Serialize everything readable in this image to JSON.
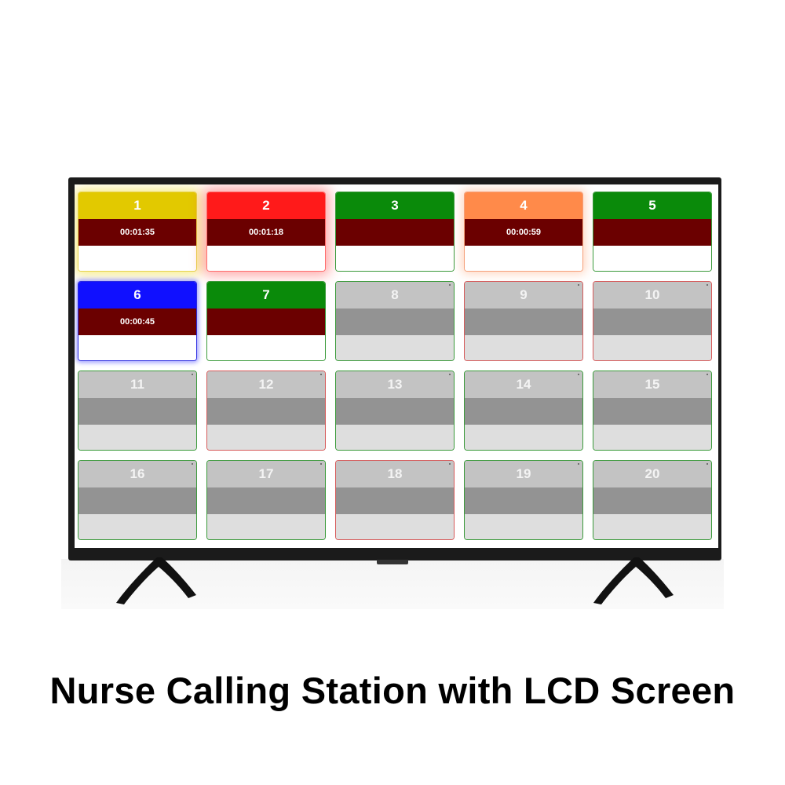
{
  "caption": "Nurse Calling Station with LCD Screen",
  "colors": {
    "active_yellow": "#e2c900",
    "active_red": "#ff1a1a",
    "active_orange": "#ff8a4a",
    "active_blue": "#1010ff",
    "ready_green": "#0a8a0a",
    "timer_band": "#6b0000",
    "idle_gray": "#c3c3c3"
  },
  "beds": [
    {
      "number": "1",
      "timer": "00:01:35",
      "state": "active",
      "color": "#e2c900"
    },
    {
      "number": "2",
      "timer": "00:01:18",
      "state": "active",
      "color": "#ff1a1a"
    },
    {
      "number": "3",
      "timer": "",
      "state": "ready",
      "color": "#0a8a0a"
    },
    {
      "number": "4",
      "timer": "00:00:59",
      "state": "active",
      "color": "#ff8a4a"
    },
    {
      "number": "5",
      "timer": "",
      "state": "ready",
      "color": "#0a8a0a"
    },
    {
      "number": "6",
      "timer": "00:00:45",
      "state": "active",
      "color": "#1010ff"
    },
    {
      "number": "7",
      "timer": "",
      "state": "ready",
      "color": "#0a8a0a"
    },
    {
      "number": "8",
      "timer": "",
      "state": "idle",
      "color": "#c3c3c3"
    },
    {
      "number": "9",
      "timer": "",
      "state": "idle",
      "color": "#c3c3c3"
    },
    {
      "number": "10",
      "timer": "",
      "state": "idle",
      "color": "#c3c3c3"
    },
    {
      "number": "11",
      "timer": "",
      "state": "idle",
      "color": "#c3c3c3"
    },
    {
      "number": "12",
      "timer": "",
      "state": "idle",
      "color": "#c3c3c3"
    },
    {
      "number": "13",
      "timer": "",
      "state": "idle",
      "color": "#c3c3c3"
    },
    {
      "number": "14",
      "timer": "",
      "state": "idle",
      "color": "#c3c3c3"
    },
    {
      "number": "15",
      "timer": "",
      "state": "idle",
      "color": "#c3c3c3"
    },
    {
      "number": "16",
      "timer": "",
      "state": "idle",
      "color": "#c3c3c3"
    },
    {
      "number": "17",
      "timer": "",
      "state": "idle",
      "color": "#c3c3c3"
    },
    {
      "number": "18",
      "timer": "",
      "state": "idle",
      "color": "#c3c3c3"
    },
    {
      "number": "19",
      "timer": "",
      "state": "idle",
      "color": "#c3c3c3"
    },
    {
      "number": "20",
      "timer": "",
      "state": "idle",
      "color": "#c3c3c3"
    }
  ]
}
